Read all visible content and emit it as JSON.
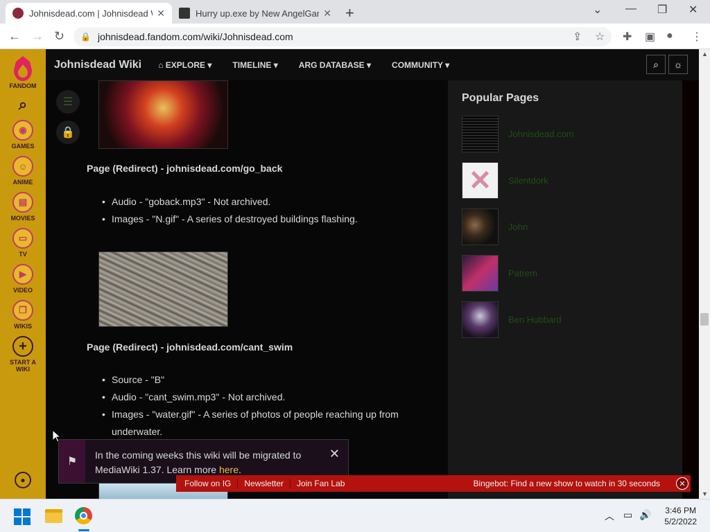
{
  "browser": {
    "tabs": [
      {
        "title": "Johnisdead.com | Johnisdead Wi",
        "active": true
      },
      {
        "title": "Hurry up.exe by New AngelGame",
        "active": false
      }
    ],
    "url": "johnisdead.fandom.com/wiki/Johnisdead.com",
    "new_tab": "+",
    "window_controls": {
      "minimize": "—",
      "restore": "❐",
      "close": "✕"
    }
  },
  "fandom_rail": {
    "brand": "FANDOM",
    "items": [
      {
        "label": "GAMES",
        "icon": "gamepad-icon"
      },
      {
        "label": "ANIME",
        "icon": "anime-icon"
      },
      {
        "label": "MOVIES",
        "icon": "movie-icon"
      },
      {
        "label": "TV",
        "icon": "tv-icon"
      },
      {
        "label": "VIDEO",
        "icon": "video-icon"
      },
      {
        "label": "WIKIS",
        "icon": "book-icon"
      },
      {
        "label": "START A WIKI",
        "icon": "plus-icon"
      }
    ]
  },
  "wiki_nav": {
    "brand": "Johnisdead Wiki",
    "links": [
      "EXPLORE",
      "TIMELINE",
      "ARG DATABASE",
      "COMMUNITY"
    ]
  },
  "content": {
    "sections": [
      {
        "heading": "Page (Redirect) - johnisdead.com/go_back",
        "bullets": [
          "Audio - \"goback.mp3\" - Not archived.",
          "Images - \"N.gif\" - A series of destroyed buildings flashing."
        ]
      },
      {
        "heading": "Page (Redirect) - johnisdead.com/cant_swim",
        "bullets": [
          "Source - \"B\"",
          "Audio - \"cant_swim.mp3\" - Not archived.",
          "Images - \"water.gif\" - A series of photos of people reaching up from underwater."
        ]
      }
    ]
  },
  "sidebar": {
    "title": "Popular Pages",
    "pages": [
      "Johnisdead.com",
      "Silentdork",
      "John",
      "Patrem",
      "Ben Hubbard"
    ]
  },
  "notice": {
    "text": "In the coming weeks this wiki will be migrated to MediaWiki 1.37. Learn more ",
    "link": "here",
    "end": "."
  },
  "bottom_bar": {
    "links": [
      "Follow on IG",
      "Newsletter",
      "Join Fan Lab"
    ],
    "promo": "Bingebot: Find a new show to watch in 30 seconds"
  },
  "taskbar": {
    "time": "3:46 PM",
    "date": "5/2/2022"
  }
}
